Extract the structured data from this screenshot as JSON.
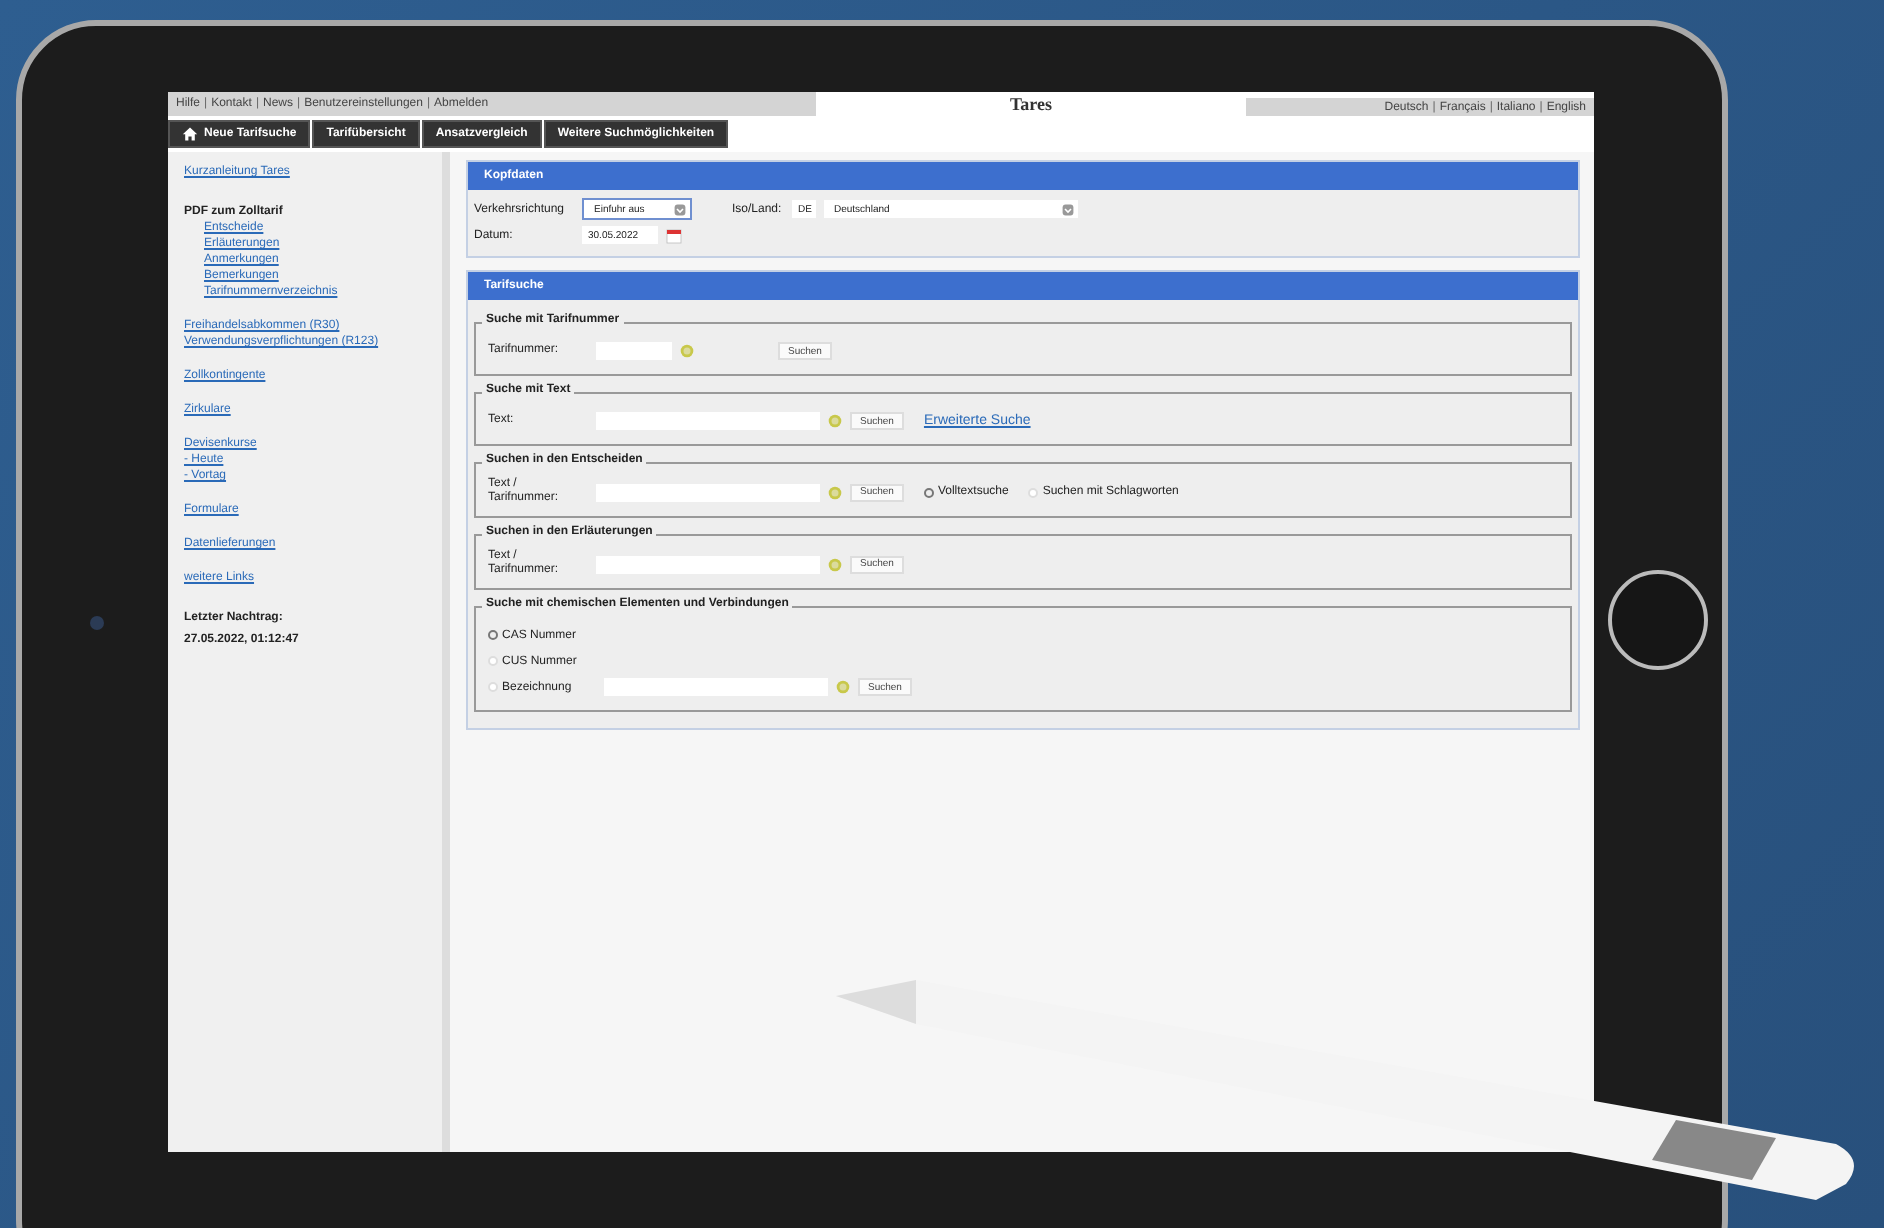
{
  "top_bar": {
    "links": [
      "Hilfe",
      "Kontakt",
      "News",
      "Benutzereinstellungen",
      "Abmelden"
    ],
    "separator": "|",
    "title": "Tares",
    "languages": [
      "Deutsch",
      "Français",
      "Italiano",
      "English"
    ]
  },
  "nav_tabs": [
    {
      "label": "Neue Tarifsuche",
      "kind": "home"
    },
    {
      "label": "Tarifübersicht",
      "kind": "plain"
    },
    {
      "label": "Ansatzvergleich",
      "kind": "plain"
    },
    {
      "label": "Weitere Suchmöglichkeiten",
      "kind": "plain"
    }
  ],
  "sidebar": {
    "groups": [
      {
        "items": [
          {
            "kind": "link",
            "text": "Kurzanleitung Tares"
          }
        ]
      },
      {
        "items": [
          {
            "kind": "heading",
            "text": "PDF zum Zolltarif"
          },
          {
            "kind": "sublink",
            "text": "Entscheide"
          },
          {
            "kind": "sublink",
            "text": "Erläuterungen"
          },
          {
            "kind": "sublink",
            "text": "Anmerkungen"
          },
          {
            "kind": "sublink",
            "text": "Bemerkungen"
          },
          {
            "kind": "sublink",
            "text": "Tarifnummernverzeichnis"
          }
        ]
      },
      {
        "items": [
          {
            "kind": "link",
            "text": "Freihandelsabkommen (R30)"
          },
          {
            "kind": "link",
            "text": "Verwendungsverpflichtungen (R123)"
          }
        ]
      },
      {
        "items": [
          {
            "kind": "link",
            "text": "Zollkontingente"
          }
        ]
      },
      {
        "items": [
          {
            "kind": "link",
            "text": "Zirkulare"
          }
        ]
      },
      {
        "items": [
          {
            "kind": "link",
            "text": "Devisenkurse"
          },
          {
            "kind": "link",
            "text": "- Heute"
          },
          {
            "kind": "link",
            "text": "- Vortag"
          }
        ]
      },
      {
        "items": [
          {
            "kind": "link",
            "text": "Formulare"
          }
        ]
      },
      {
        "items": [
          {
            "kind": "link",
            "text": "Datenlieferungen"
          }
        ]
      },
      {
        "items": [
          {
            "kind": "link",
            "text": "weitere Links"
          }
        ]
      },
      {
        "items": [
          {
            "kind": "heading",
            "text": "Letzter Nachtrag:"
          },
          {
            "kind": "heading",
            "text": "27.05.2022, 01:12:47"
          }
        ]
      }
    ]
  },
  "header_panel": {
    "title": "Kopfdaten",
    "direction_label": "Verkehrsrichtung",
    "direction_value": "Einfuhr aus",
    "country_label": "Iso/Land:",
    "country_code": "DE",
    "country_value": "Deutschland",
    "date_label": "Datum:",
    "date_value": "30.05.2022"
  },
  "search_panel": {
    "title": "Tarifsuche",
    "sections": [
      {
        "legend": "Suche mit Tarifnummer",
        "rows": [
          {
            "kind": "short-field",
            "label": "Tarifnummer:",
            "button": "Suchen"
          }
        ]
      },
      {
        "legend": "Suche mit Text",
        "rows": [
          {
            "kind": "field",
            "label": "Text:",
            "button": "Suchen",
            "link": "Erweiterte Suche"
          }
        ]
      },
      {
        "legend": "Suchen in den Entscheiden",
        "rows": [
          {
            "kind": "field",
            "label": "Text / Tarifnummer:",
            "button": "Suchen",
            "options": [
              {
                "label": "Volltextsuche",
                "selected": true
              },
              {
                "label": "Suchen mit Schlagworten",
                "selected": false
              }
            ]
          }
        ]
      },
      {
        "legend": "Suchen in den Erläuterungen",
        "rows": [
          {
            "kind": "field",
            "label": "Text / Tarifnummer:",
            "button": "Suchen"
          }
        ]
      },
      {
        "legend": "Suche mit chemischen Elementen und Verbindungen",
        "rows": [
          {
            "kind": "radio",
            "label": "CAS Nummer",
            "selected": true
          },
          {
            "kind": "radio",
            "label": "CUS Nummer",
            "selected": false
          },
          {
            "kind": "radio-field",
            "label": "Bezeichnung",
            "selected": false,
            "button": "Suchen"
          }
        ]
      }
    ]
  }
}
